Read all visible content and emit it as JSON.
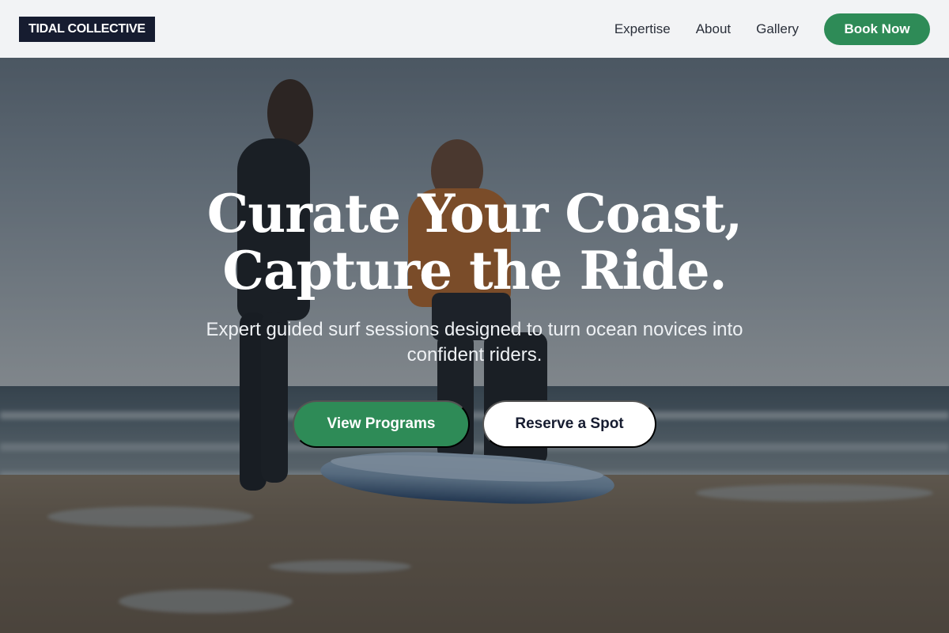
{
  "header": {
    "logo_text": "TIDAL COLLECTIVE",
    "nav": [
      {
        "label": "Expertise"
      },
      {
        "label": "About"
      },
      {
        "label": "Gallery"
      }
    ],
    "cta_label": "Book Now"
  },
  "hero": {
    "headline_line1": "Curate Your Coast,",
    "headline_line2": "Capture the Ride.",
    "subtext": "Expert guided surf sessions designed to turn ocean novices into confident riders.",
    "primary_cta": "View Programs",
    "secondary_cta": "Reserve a Spot"
  },
  "colors": {
    "brand_dark": "#161c30",
    "accent_green": "#2e8b57",
    "header_bg": "#f2f3f5",
    "text_white": "#ffffff"
  }
}
